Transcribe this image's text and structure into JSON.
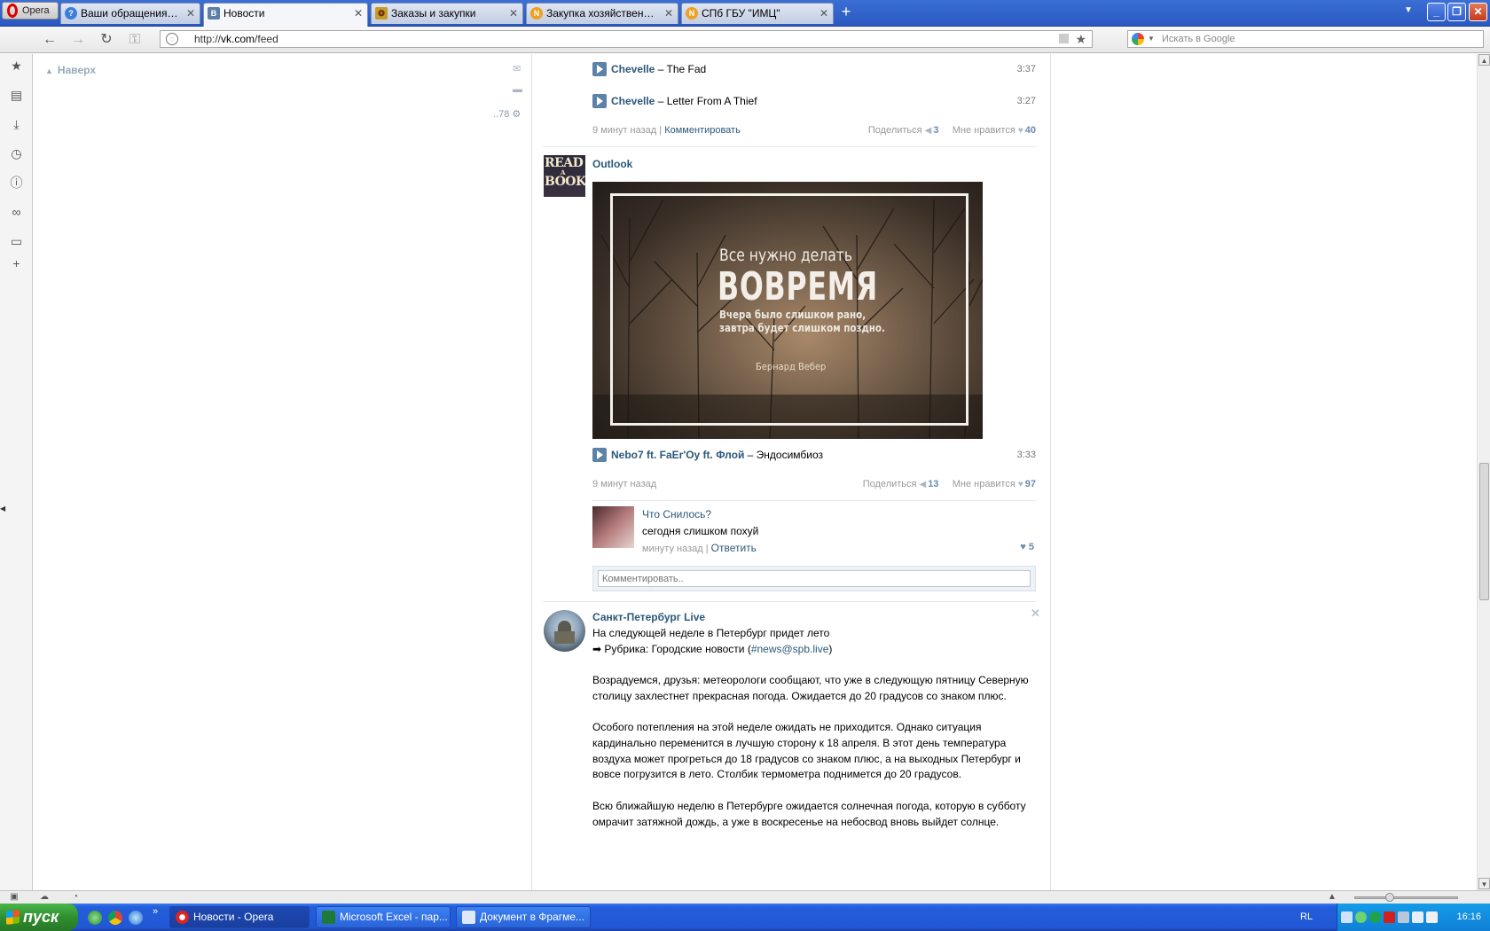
{
  "browser": {
    "menu_label": "Opera",
    "tabs": [
      {
        "label": "Ваши обращения | Help...",
        "fav": "?"
      },
      {
        "label": "Новости",
        "fav": "В"
      },
      {
        "label": "Заказы и закупки",
        "fav": "❂"
      },
      {
        "label": "Закупка хозяйственны...",
        "fav": "N"
      },
      {
        "label": "СПб ГБУ \"ИМЦ\"",
        "fav": "N"
      }
    ],
    "address": {
      "scheme": "http://",
      "host": "vk.com",
      "path": "/feed"
    },
    "search_placeholder": "Искать в Google"
  },
  "left": {
    "to_top": "Наверх",
    "counter": "..78"
  },
  "post1": {
    "tracks": [
      {
        "artist": "Chevelle",
        "title": "The Fad",
        "duration": "3:37"
      },
      {
        "artist": "Chevelle",
        "title": "Letter From A Thief",
        "duration": "3:27"
      }
    ],
    "time": "9 минут назад",
    "comment_link": "Комментировать",
    "share_label": "Поделиться",
    "share_count": "3",
    "like_label": "Мне нравится",
    "like_count": "40"
  },
  "post2": {
    "author": "Outlook",
    "avatar_lines": [
      "READ",
      "A",
      "BOOK"
    ],
    "image_quote": {
      "line1": "Все нужно делать",
      "line2": "ВОВРЕМЯ",
      "line3": "Вчера было слишком рано,",
      "line4": "завтра будет слишком поздно.",
      "author": "Бернард Вебер"
    },
    "track": {
      "artist": "Nebo7 ft. FaEr'Oy ft. Флой",
      "title": "Эндосимбиоз",
      "duration": "3:33"
    },
    "time": "9 минут назад",
    "share_label": "Поделиться",
    "share_count": "13",
    "like_label": "Мне нравится",
    "like_count": "97",
    "reply": {
      "name": "Что Снилось?",
      "text": "сегодня слишком похуй",
      "time": "минуту назад",
      "reply_link": "Ответить",
      "likes": "5"
    },
    "comment_placeholder": "Комментировать.."
  },
  "post3": {
    "author": "Санкт-Петербург Live",
    "headline": "На следующей неделе в Петербург придет лето",
    "rubric_prefix": "Рубрика: Городские новости (",
    "rubric_tag": "#news@spb.live",
    "rubric_suffix": ")",
    "paragraph1": "Возрадуемся, друзья: метеорологи сообщают, что уже в следующую пятницу Северную столицу захлестнет прекрасная погода. Ожидается до 20 градусов со знаком плюс.",
    "paragraph2": "Особого потепления на этой неделе ожидать не приходится. Однако ситуация кардинально переменится в лучшую сторону к 18 апреля. В этот день температура воздуха может прогреться до 18 градусов со знаком плюс, а на выходных Петербург и вовсе погрузится в лето. Столбик термометра поднимется до 20 градусов.",
    "paragraph3": "Всю ближайшую неделю в Петербурге ожидается солнечная погода, которую в субботу омрачит затяжной дождь, а уже в воскресенье на небосвод вновь выйдет солнце."
  },
  "taskbar": {
    "start_label": "пуск",
    "tasks": [
      {
        "label": "Новости - Opera"
      },
      {
        "label": "Microsoft Excel - пар..."
      },
      {
        "label": "Документ в Фрагме..."
      }
    ],
    "lang": "RL",
    "clock": "16:16"
  }
}
